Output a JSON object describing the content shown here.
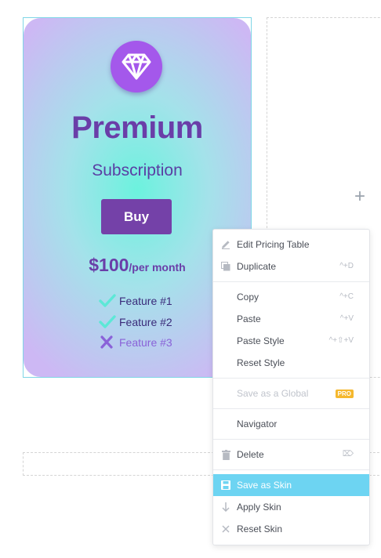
{
  "card": {
    "title": "Premium",
    "subtitle": "Subscription",
    "button_label": "Buy",
    "price_amount": "$100",
    "price_period": "/per month",
    "features": [
      {
        "label": "Feature #1",
        "included": true
      },
      {
        "label": "Feature #2",
        "included": true
      },
      {
        "label": "Feature #3",
        "included": false
      }
    ],
    "accent_color": "#7441a8",
    "check_color": "#5de8d6",
    "cross_color": "#8a62d8"
  },
  "empty_column": {
    "add_icon": "plus-icon"
  },
  "context_menu": {
    "groups": [
      [
        {
          "label": "Edit Pricing Table",
          "icon": "pencil-icon",
          "shortcut": ""
        },
        {
          "label": "Duplicate",
          "icon": "duplicate-icon",
          "shortcut": "^+D"
        }
      ],
      [
        {
          "label": "Copy",
          "icon": "",
          "shortcut": "^+C"
        },
        {
          "label": "Paste",
          "icon": "",
          "shortcut": "^+V"
        },
        {
          "label": "Paste Style",
          "icon": "",
          "shortcut": "^+⇧+V"
        },
        {
          "label": "Reset Style",
          "icon": "",
          "shortcut": ""
        }
      ],
      [
        {
          "label": "Save as a Global",
          "icon": "",
          "badge": "PRO",
          "disabled": true
        }
      ],
      [
        {
          "label": "Navigator",
          "icon": "",
          "shortcut": ""
        }
      ],
      [
        {
          "label": "Delete",
          "icon": "trash-icon",
          "shortcut": "⌦"
        }
      ],
      [
        {
          "label": "Save as Skin",
          "icon": "save-icon",
          "active": true
        },
        {
          "label": "Apply Skin",
          "icon": "arrow-down-icon"
        },
        {
          "label": "Reset Skin",
          "icon": "close-icon"
        }
      ]
    ],
    "highlight_color": "#6dd4f2"
  }
}
